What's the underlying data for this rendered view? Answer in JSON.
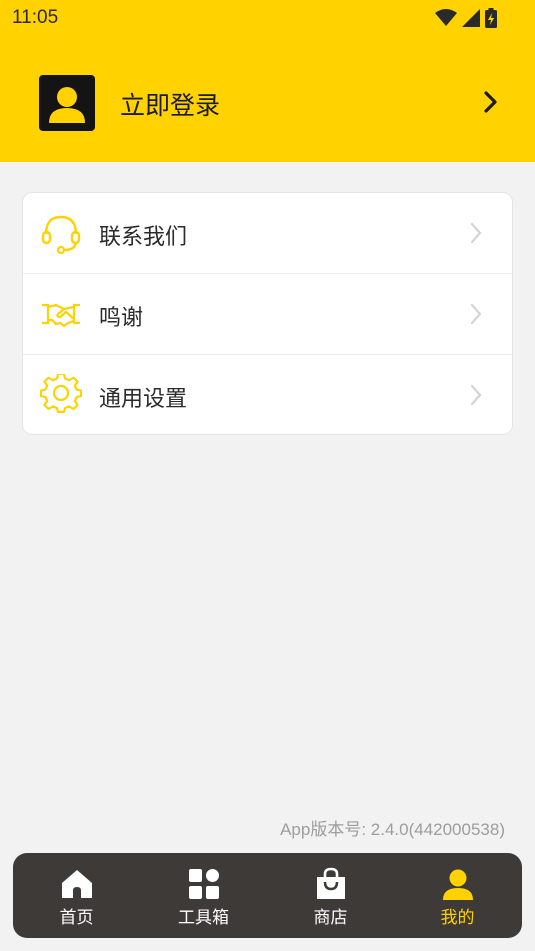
{
  "status_bar": {
    "time": "11:05"
  },
  "header": {
    "login_label": "立即登录"
  },
  "menu": [
    {
      "label": "联系我们",
      "icon": "headset-icon"
    },
    {
      "label": "鸣谢",
      "icon": "handshake-icon"
    },
    {
      "label": "通用设置",
      "icon": "gear-icon"
    }
  ],
  "footer": {
    "version": "App版本号: 2.4.0(442000538)"
  },
  "tabs": [
    {
      "label": "首页",
      "icon": "home-icon",
      "active": false
    },
    {
      "label": "工具箱",
      "icon": "grid-icon",
      "active": false
    },
    {
      "label": "商店",
      "icon": "shopping-bag-icon",
      "active": false
    },
    {
      "label": "我的",
      "icon": "user-icon",
      "active": true
    }
  ],
  "colors": {
    "accent": "#ffd200",
    "tabbar": "#3e3a38",
    "background": "#f2f2f2"
  }
}
